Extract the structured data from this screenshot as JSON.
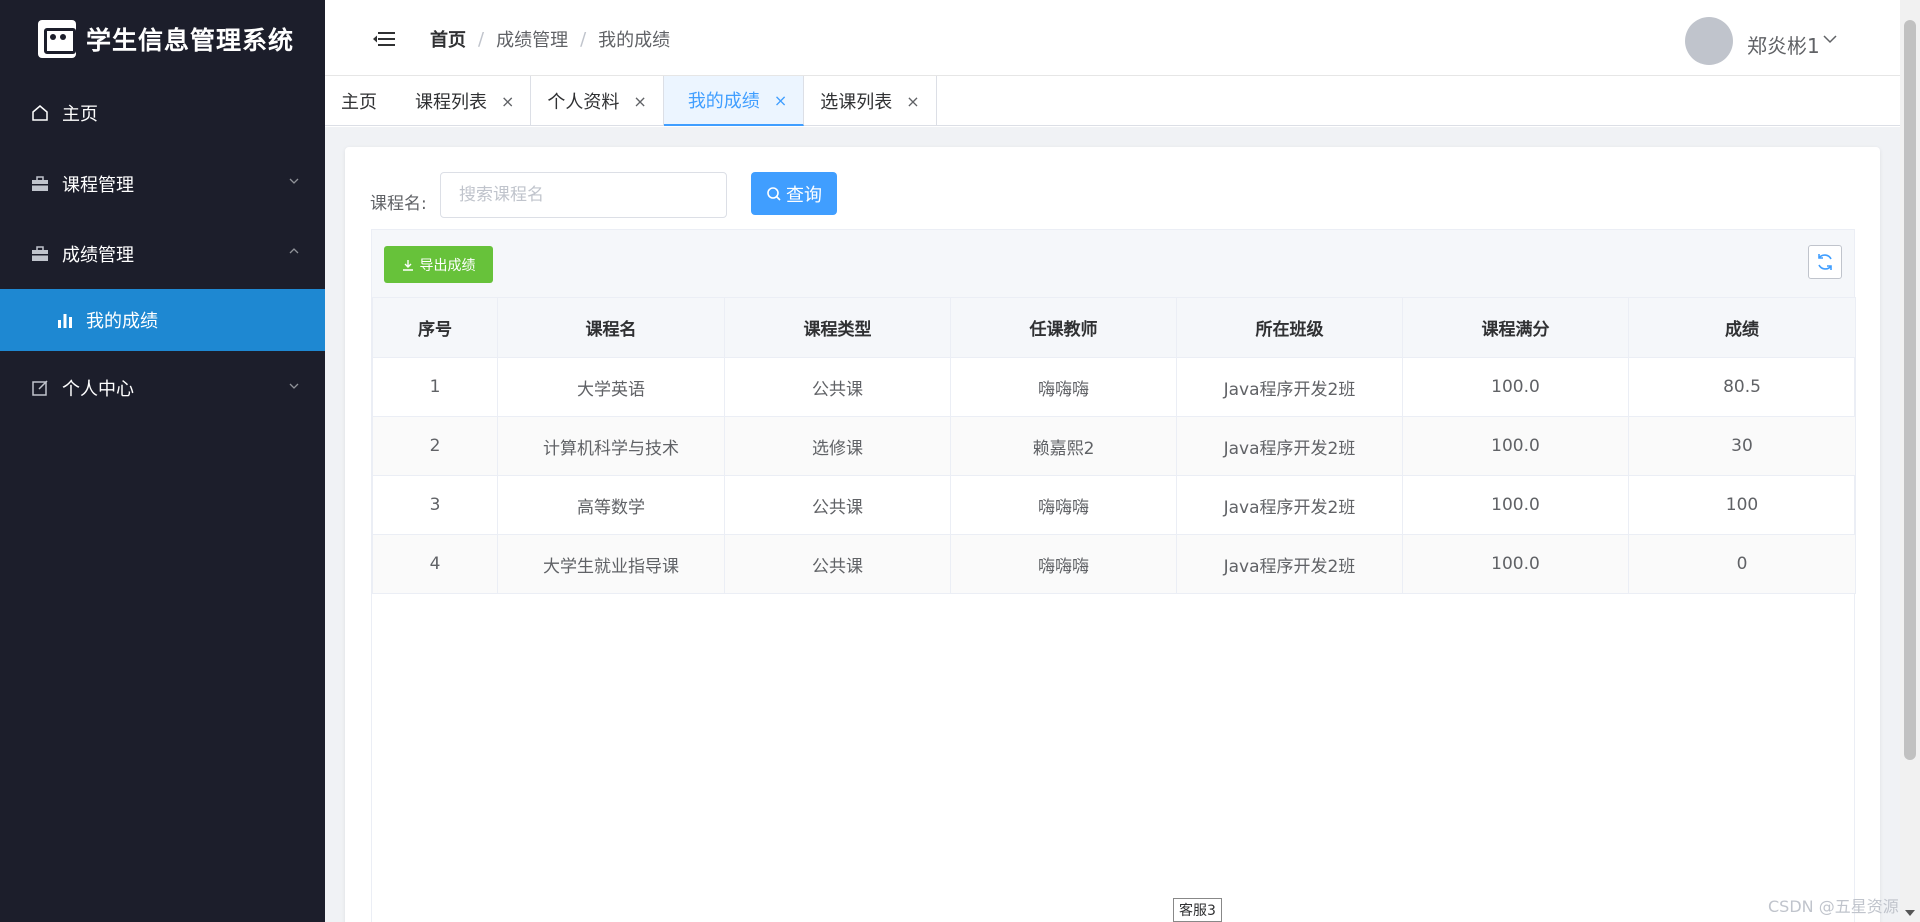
{
  "app": {
    "title": "学生信息管理系统"
  },
  "sidebar": {
    "items": [
      {
        "label": "主页",
        "icon": "home-icon"
      },
      {
        "label": "课程管理",
        "icon": "briefcase-icon"
      },
      {
        "label": "成绩管理",
        "icon": "briefcase-icon"
      },
      {
        "label": "个人中心",
        "icon": "edit-icon"
      }
    ],
    "sub_item": {
      "label": "我的成绩",
      "icon": "bar-chart-icon"
    }
  },
  "header": {
    "breadcrumb": [
      "首页",
      "成绩管理",
      "我的成绩"
    ],
    "user_name": "郑炎彬1"
  },
  "tabs": [
    {
      "label": "主页"
    },
    {
      "label": "课程列表"
    },
    {
      "label": "个人资料"
    },
    {
      "label": "我的成绩",
      "active": true
    },
    {
      "label": "选课列表"
    }
  ],
  "search": {
    "label": "课程名:",
    "placeholder": "搜索课程名",
    "button": "查询"
  },
  "toolbar": {
    "export_label": "导出成绩"
  },
  "table": {
    "headers": [
      "序号",
      "课程名",
      "课程类型",
      "任课教师",
      "所在班级",
      "课程满分",
      "成绩"
    ],
    "rows": [
      [
        "1",
        "大学英语",
        "公共课",
        "嗨嗨嗨",
        "Java程序开发2班",
        "100.0",
        "80.5"
      ],
      [
        "2",
        "计算机科学与技术",
        "选修课",
        "赖嘉熙2",
        "Java程序开发2班",
        "100.0",
        "30"
      ],
      [
        "3",
        "高等数学",
        "公共课",
        "嗨嗨嗨",
        "Java程序开发2班",
        "100.0",
        "100"
      ],
      [
        "4",
        "大学生就业指导课",
        "公共课",
        "嗨嗨嗨",
        "Java程序开发2班",
        "100.0",
        "0"
      ]
    ]
  },
  "overlay": {
    "badge": "客服3",
    "watermark": "CSDN @五星资源"
  },
  "colors": {
    "sidebar_bg": "#1c1e2b",
    "active_menu": "#1e88d2",
    "primary": "#409eff",
    "success": "#67c23a"
  }
}
